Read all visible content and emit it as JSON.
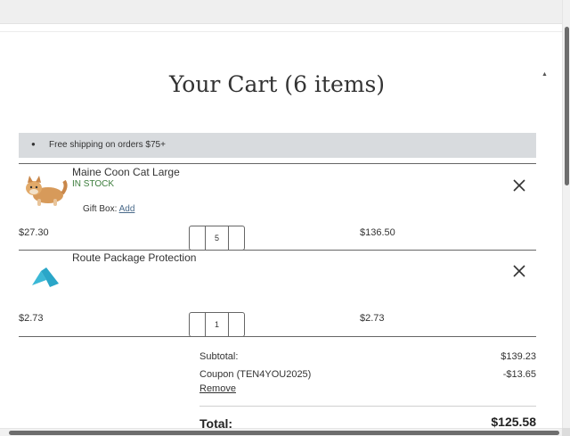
{
  "cart": {
    "title": "Your Cart (6 items)",
    "banner": "Free shipping on orders $75+",
    "items": [
      {
        "name": "Maine Coon Cat Large",
        "stock": "IN STOCK",
        "gift_label": "Gift Box:",
        "gift_link": "Add",
        "unit_price": "$27.30",
        "quantity": "5",
        "line_total": "$136.50"
      },
      {
        "name": "Route Package Protection",
        "unit_price": "$2.73",
        "quantity": "1",
        "line_total": "$2.73"
      }
    ]
  },
  "summary": {
    "subtotal_label": "Subtotal:",
    "subtotal_value": "$139.23",
    "coupon_label": "Coupon (TEN4YOU2025)",
    "coupon_value": "-$13.65",
    "remove_label": "Remove",
    "total_label": "Total:",
    "total_value": "$125.58"
  },
  "icons": {
    "tag": "tag-icon",
    "remove": "close-icon",
    "scroll_up": "caret-up-icon"
  },
  "colors": {
    "banner_bg": "#d8dbde",
    "stock_green": "#3c7d3c",
    "route_teal": "#3bb8d6"
  }
}
